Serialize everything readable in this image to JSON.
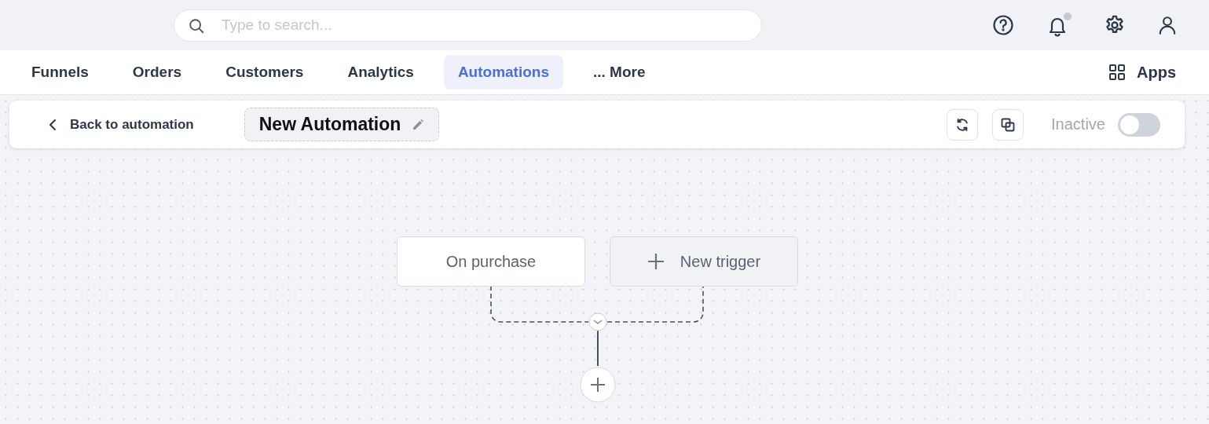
{
  "search": {
    "placeholder": "Type to search..."
  },
  "nav": {
    "tabs": [
      {
        "label": "Funnels",
        "selected": false
      },
      {
        "label": "Orders",
        "selected": false
      },
      {
        "label": "Customers",
        "selected": false
      },
      {
        "label": "Analytics",
        "selected": false
      },
      {
        "label": "Automations",
        "selected": true
      },
      {
        "label": "... More",
        "selected": false
      }
    ],
    "apps": "Apps"
  },
  "toolbar": {
    "back": "Back to automation",
    "title": "New Automation",
    "status": "Inactive",
    "active": false
  },
  "flow": {
    "triggers": [
      {
        "label": "On purchase",
        "kind": "trigger"
      },
      {
        "label": "New trigger",
        "kind": "add"
      }
    ]
  }
}
